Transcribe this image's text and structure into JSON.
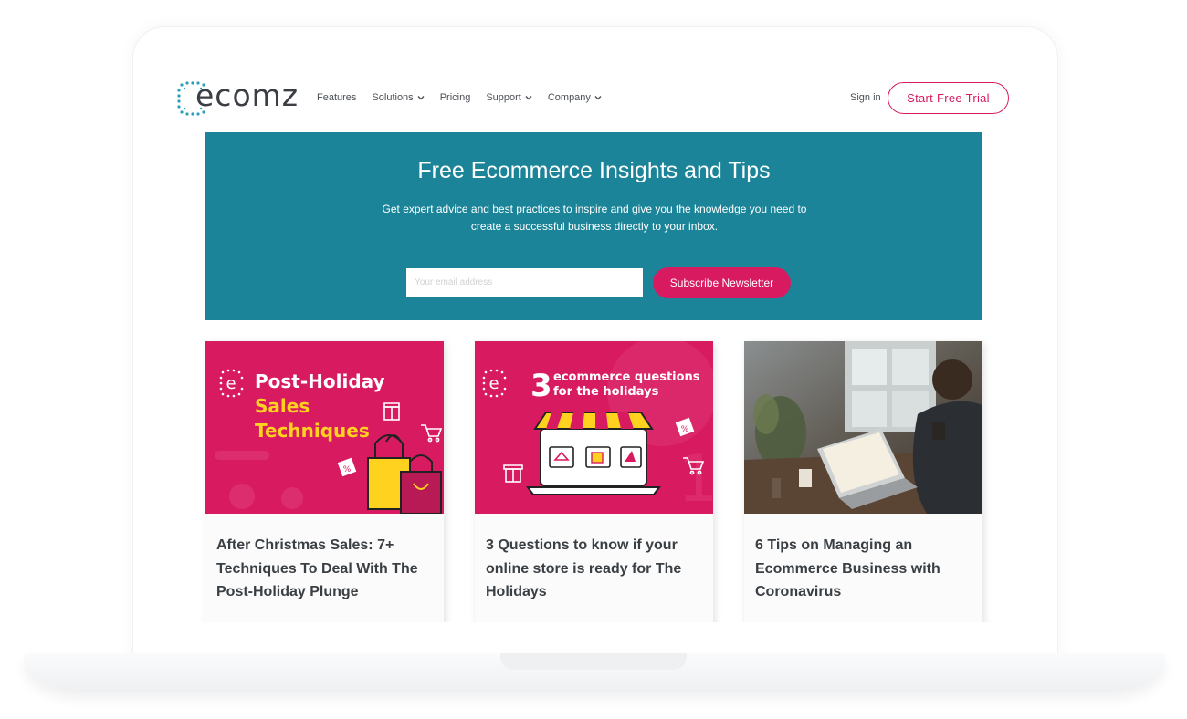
{
  "brand": {
    "logo_text": "ecomz",
    "accent": "#d81b60",
    "hero_bg": "#1c8498"
  },
  "nav": {
    "items": [
      {
        "label": "Features",
        "dropdown": false
      },
      {
        "label": "Solutions",
        "dropdown": true
      },
      {
        "label": "Pricing",
        "dropdown": false
      },
      {
        "label": "Support",
        "dropdown": true
      },
      {
        "label": "Company",
        "dropdown": true
      }
    ],
    "signin_label": "Sign in",
    "trial_label": "Start Free Trial"
  },
  "hero": {
    "title": "Free Ecommerce Insights and Tips",
    "subtitle": "Get expert advice and best practices to inspire and give you the knowledge you need to create a successful business directly to your inbox.",
    "email_placeholder": "Your email address",
    "subscribe_label": "Subscribe Newsletter"
  },
  "cards": [
    {
      "title": "After Christmas Sales: 7+ Techniques To Deal With The Post-Holiday Plunge",
      "image": {
        "line1": "Post-Holiday",
        "line2": "Sales",
        "line3": "Techniques",
        "badge": "%",
        "icons": [
          "ecomz-logo-icon",
          "gift-icon",
          "cart-icon",
          "shopping-bag-icon"
        ]
      }
    },
    {
      "title": "3 Questions to know if your online store is ready for The Holidays",
      "image": {
        "number": "3",
        "line1": "ecommerce questions",
        "line2": "for the holidays",
        "badge": "%",
        "icons": [
          "ecomz-logo-icon",
          "storefront-laptop-icon",
          "gift-icon",
          "cart-icon"
        ]
      }
    },
    {
      "title": "6 Tips on Managing an Ecommerce Business with Coronavirus",
      "image": {
        "icons": [
          "person-laptop-photo"
        ]
      }
    }
  ]
}
